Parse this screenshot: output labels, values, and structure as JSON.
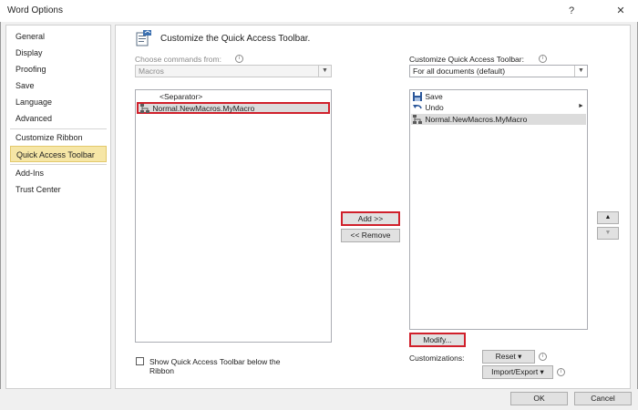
{
  "window": {
    "title": "Word Options",
    "help_label": "?",
    "close_label": "✕"
  },
  "nav": {
    "items": [
      {
        "label": "General"
      },
      {
        "label": "Display"
      },
      {
        "label": "Proofing"
      },
      {
        "label": "Save"
      },
      {
        "label": "Language"
      },
      {
        "label": "Advanced"
      },
      {
        "label": "Customize Ribbon"
      },
      {
        "label": "Quick Access Toolbar"
      },
      {
        "label": "Add-Ins"
      },
      {
        "label": "Trust Center"
      }
    ],
    "selected": "Quick Access Toolbar"
  },
  "header": {
    "title": "Customize the Quick Access Toolbar."
  },
  "left": {
    "choose_label": "Choose commands from:",
    "choose_value": "Macros",
    "items": [
      {
        "label": "<Separator>"
      },
      {
        "label": "Normal.NewMacros.MyMacro"
      }
    ]
  },
  "right": {
    "customize_label": "Customize Quick Access Toolbar:",
    "customize_value": "For all documents (default)",
    "items": [
      {
        "label": "Save",
        "icon": "save-icon"
      },
      {
        "label": "Undo",
        "icon": "undo-icon"
      },
      {
        "label": "Normal.NewMacros.MyMacro",
        "icon": "macro-icon"
      }
    ]
  },
  "actions": {
    "add_label": "Add >>",
    "remove_label": "<< Remove",
    "modify_label": "Modify...",
    "customizations_label": "Customizations:",
    "reset_label": "Reset ▾",
    "import_export_label": "Import/Export ▾",
    "show_below_line1": "Show Quick Access Toolbar below the",
    "show_below_line2": "Ribbon",
    "move_up": "▲",
    "move_down": "▼"
  },
  "footer": {
    "ok_label": "OK",
    "cancel_label": "Cancel"
  },
  "colors": {
    "highlight_red": "#d0202b",
    "selected_nav": "#f6e6a6"
  }
}
